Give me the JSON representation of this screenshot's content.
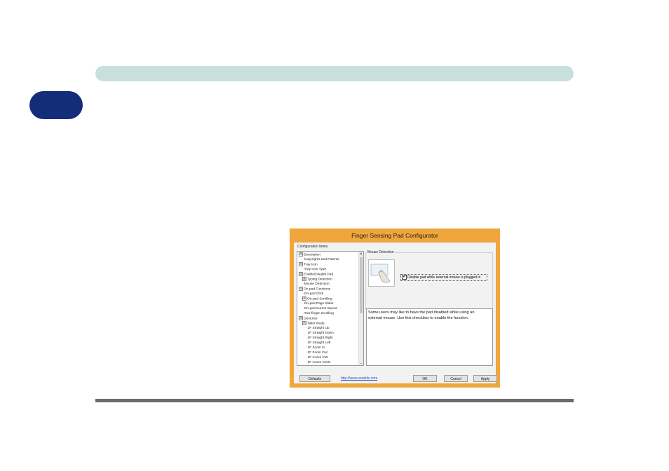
{
  "dialog": {
    "title": "Finger Sensing Pad Configurator",
    "config_label": "Configuration Items",
    "tree_items": [
      {
        "label": "Description",
        "exp": "⊟",
        "indent": 0
      },
      {
        "label": "Copyrights and Patents",
        "exp": "",
        "indent": 1
      },
      {
        "label": "Tray Icon",
        "exp": "⊟",
        "indent": 0
      },
      {
        "label": "Tray Icon Type",
        "exp": "",
        "indent": 1
      },
      {
        "label": "Enable/Disable Pad",
        "exp": "⊟",
        "indent": 0
      },
      {
        "label": "Typing Detection",
        "exp": "⊞",
        "indent": 1
      },
      {
        "label": "Mouse Detection",
        "exp": "",
        "indent": 1
      },
      {
        "label": "On-pad Functions",
        "exp": "⊟",
        "indent": 0
      },
      {
        "label": "On-pad Click",
        "exp": "",
        "indent": 1
      },
      {
        "label": "On-pad Scrolling",
        "exp": "⊞",
        "indent": 1
      },
      {
        "label": "On-pad Page Slider",
        "exp": "",
        "indent": 1
      },
      {
        "label": "On-pad Cursor Speed",
        "exp": "",
        "indent": 1
      },
      {
        "label": "Two-finger Scrolling",
        "exp": "",
        "indent": 1
      },
      {
        "label": "Gestures",
        "exp": "⊟",
        "indent": 0
      },
      {
        "label": "Tailor mode",
        "exp": "⊟",
        "indent": 1
      },
      {
        "label": "2F Straight Up",
        "exp": "",
        "indent": 2
      },
      {
        "label": "2F Straight Down",
        "exp": "",
        "indent": 2
      },
      {
        "label": "2F Straight Right",
        "exp": "",
        "indent": 2
      },
      {
        "label": "2F Straight Left",
        "exp": "",
        "indent": 2
      },
      {
        "label": "2F Zoom In",
        "exp": "",
        "indent": 2
      },
      {
        "label": "2F Zoom Out",
        "exp": "",
        "indent": 2
      },
      {
        "label": "2F Curve CW",
        "exp": "",
        "indent": 2
      },
      {
        "label": "2F Curve CCW",
        "exp": "",
        "indent": 2
      }
    ],
    "group_label": "Mouse Detection",
    "checkbox_label": "Disable pad while external mouse is plugged in",
    "checkbox_checked": "✔",
    "description": "Some users may like to have the pad disabled while using an external mouse. Use this checkbox to enable the function.",
    "link": "http://www.sentelic.com",
    "buttons": {
      "defaults": "Defaults",
      "ok": "OK",
      "cancel": "Cancel",
      "apply": "Apply"
    }
  },
  "colors": {
    "header_bar": "#c8dfdc",
    "chapter_tab": "#132d7a",
    "dialog_frame": "#f0a63c"
  }
}
